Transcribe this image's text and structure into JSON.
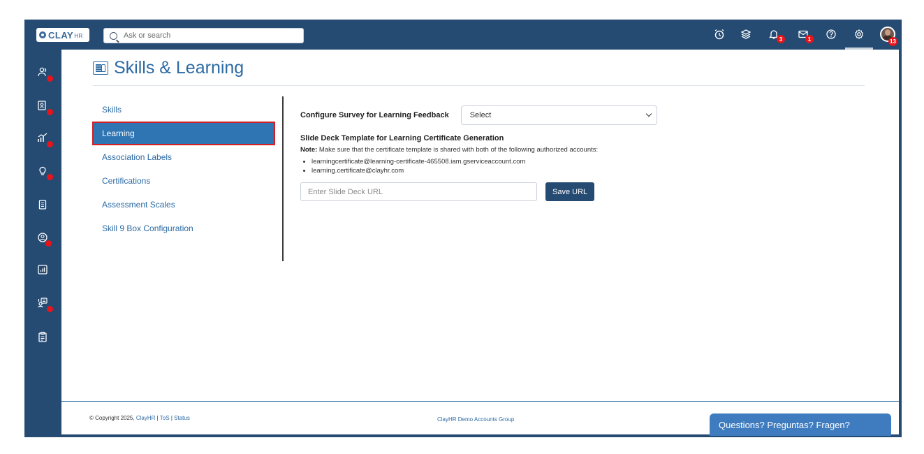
{
  "brand": {
    "logo_text": "CLAY",
    "logo_suffix": "HR"
  },
  "search": {
    "placeholder": "Ask or search"
  },
  "top_icons": [
    {
      "name": "alarm-clock-icon"
    },
    {
      "name": "layers-icon"
    },
    {
      "name": "bell-icon",
      "badge": "3"
    },
    {
      "name": "mail-icon",
      "badge": "1"
    },
    {
      "name": "help-icon"
    },
    {
      "name": "gear-icon"
    },
    {
      "name": "avatar",
      "badge": "13"
    }
  ],
  "sidebar": {
    "items": [
      {
        "icon": "people-icon",
        "dot": true
      },
      {
        "icon": "badge-card-icon",
        "dot": true
      },
      {
        "icon": "growth-chart-icon",
        "dot": true
      },
      {
        "icon": "lightbulb-icon",
        "dot": true
      },
      {
        "icon": "document-icon",
        "dot": false
      },
      {
        "icon": "user-circle-icon",
        "dot": true
      },
      {
        "icon": "report-chart-icon",
        "dot": false
      },
      {
        "icon": "learning-icon",
        "dot": true
      },
      {
        "icon": "clipboard-icon",
        "dot": false
      }
    ]
  },
  "page": {
    "title": "Skills & Learning"
  },
  "subnav": {
    "items": [
      {
        "label": "Skills",
        "active": false
      },
      {
        "label": "Learning",
        "active": true
      },
      {
        "label": "Association Labels",
        "active": false
      },
      {
        "label": "Certifications",
        "active": false
      },
      {
        "label": "Assessment Scales",
        "active": false
      },
      {
        "label": "Skill 9 Box Configuration",
        "active": false
      }
    ]
  },
  "content": {
    "survey_label": "Configure Survey for Learning Feedback",
    "survey_select_value": "Select",
    "deck_heading": "Slide Deck Template for Learning Certificate Generation",
    "note_label": "Note:",
    "note_text": " Make sure that the certificate template is shared with both of the following authorized accounts:",
    "accounts": [
      "learningcertificate@learning-certificate-465508.iam.gserviceaccount.com",
      "learning.certificate@clayhr.com"
    ],
    "deck_url_placeholder": "Enter Slide Deck URL",
    "save_label": "Save URL"
  },
  "footer": {
    "copyright": "© Copyright 2025,",
    "brand_link": "ClayHR",
    "sep": "|",
    "tos": "ToS",
    "status": "Status",
    "group": "ClayHR Demo Accounts Group",
    "help": "Questions? Preguntas? Fragen?"
  },
  "colors": {
    "nav_bg": "#254b73",
    "accent": "#2c6aa3",
    "active_item": "#2f74b3",
    "badge": "#e8141b"
  }
}
